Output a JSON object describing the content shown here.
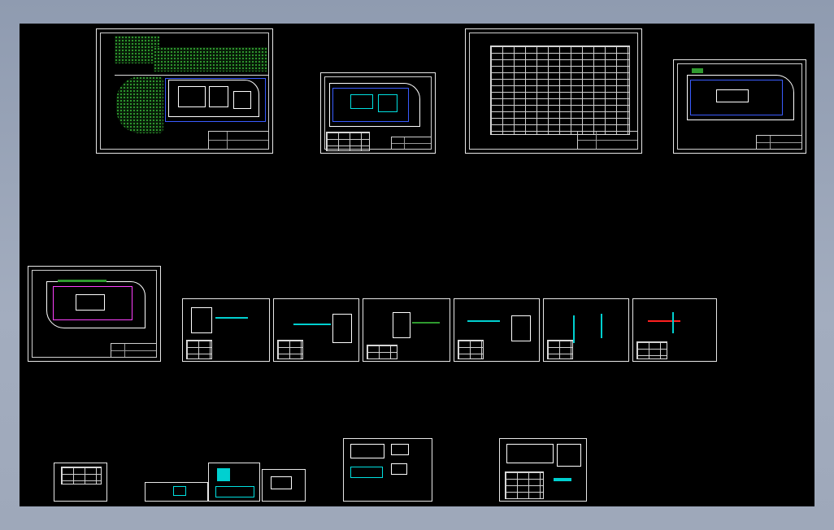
{
  "window": {
    "background": "#8f9bb0",
    "canvas_color": "#000000"
  },
  "drawings": {
    "row1": [
      "site-plan-1",
      "site-plan-2",
      "equipment-table",
      "site-plan-3"
    ],
    "row2": [
      "site-plan-4",
      "iso-1",
      "iso-2",
      "iso-3",
      "iso-4",
      "iso-5",
      "iso-6"
    ],
    "row3": [
      "detail-1",
      "detail-2",
      "detail-3",
      "detail-4",
      "detail-5",
      "detail-6"
    ]
  },
  "colors": {
    "sheet_border": "#e8e8e8",
    "green": "#2f9a2f",
    "blue": "#3a5cff",
    "cyan": "#00e0e0",
    "red": "#ff2020",
    "magenta": "#ff40ff"
  }
}
